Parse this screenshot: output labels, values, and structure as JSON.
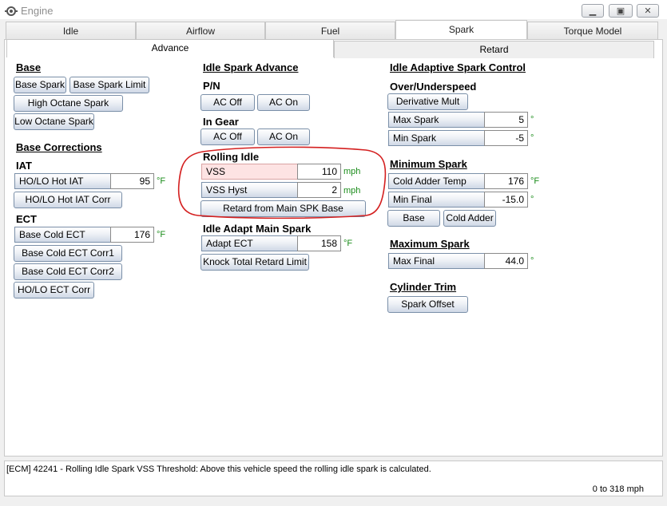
{
  "window": {
    "title": "Engine",
    "icon": "engine-icon"
  },
  "tabs": [
    "Idle",
    "Airflow",
    "Fuel",
    "Spark",
    "Torque Model"
  ],
  "subtabs": [
    "Advance",
    "Retard"
  ],
  "left": {
    "base_title": "Base",
    "base_spark": "Base Spark",
    "base_spark_limit": "Base Spark Limit",
    "high_octane": "High Octane Spark",
    "low_octane": "Low Octane Spark",
    "corrections_title": "Base Corrections",
    "iat_title": "IAT",
    "iat_label": "HO/LO Hot IAT",
    "iat_value": "95",
    "iat_unit": "°F",
    "iat_corr": "HO/LO Hot IAT Corr",
    "ect_title": "ECT",
    "ect_label": "Base Cold ECT",
    "ect_value": "176",
    "ect_unit": "°F",
    "ect_corr1": "Base Cold ECT Corr1",
    "ect_corr2": "Base Cold ECT Corr2",
    "holo_ect_corr": "HO/LO ECT Corr"
  },
  "middle": {
    "idle_title": "Idle Spark Advance",
    "pn_title": "P/N",
    "ac_off": "AC Off",
    "ac_on": "AC On",
    "ingear_title": "In Gear",
    "rolling_title": "Rolling Idle",
    "vss_label": "VSS",
    "vss_value": "110",
    "vss_unit": "mph",
    "vsshyst_label": "VSS Hyst",
    "vsshyst_value": "2",
    "vsshyst_unit": "mph",
    "retard_btn": "Retard from Main SPK Base",
    "adapt_title": "Idle Adapt Main Spark",
    "adapt_label": "Adapt ECT",
    "adapt_value": "158",
    "adapt_unit": "°F",
    "knock_btn": "Knock Total Retard Limit"
  },
  "right": {
    "adaptive_title": "Idle Adaptive Spark Control",
    "overunder_title": "Over/Underspeed",
    "deriv_btn": "Derivative Mult",
    "maxspark_label": "Max Spark",
    "maxspark_value": "5",
    "minspark_label": "Min Spark",
    "minspark_value": "-5",
    "deg_unit": "°",
    "minimum_title": "Minimum Spark",
    "coldadd_label": "Cold Adder Temp",
    "coldadd_value": "176",
    "coldadd_unit": "°F",
    "minfinal_label": "Min Final",
    "minfinal_value": "-15.0",
    "base_btn": "Base",
    "coldadder_btn": "Cold Adder",
    "maximum_title": "Maximum Spark",
    "maxfinal_label": "Max Final",
    "maxfinal_value": "44.0",
    "cyl_title": "Cylinder Trim",
    "sparkoffset_btn": "Spark Offset"
  },
  "status": {
    "text": "[ECM] 42241 - Rolling Idle Spark VSS Threshold: Above this vehicle speed the rolling idle spark is calculated.",
    "range": "0 to 318 mph"
  },
  "highlight_color": "#d42020"
}
